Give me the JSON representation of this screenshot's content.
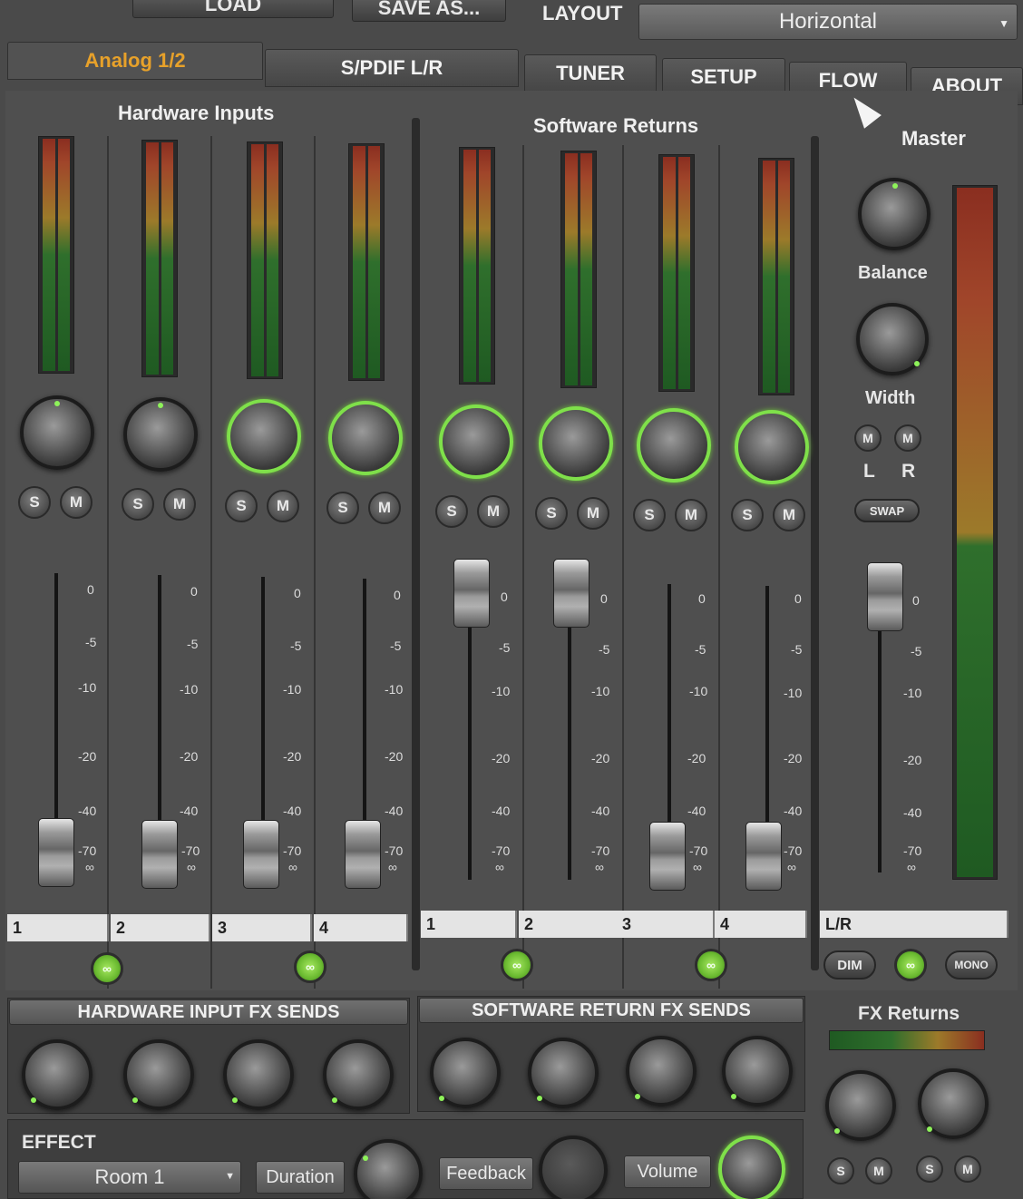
{
  "topbar": {
    "load_label": "LOAD",
    "save_as_label": "SAVE AS...",
    "layout_label": "LAYOUT",
    "layout_value": "Horizontal"
  },
  "tabs": [
    {
      "label": "Analog 1/2",
      "active": true
    },
    {
      "label": "S/PDIF L/R",
      "active": false
    },
    {
      "label": "TUNER",
      "active": false
    },
    {
      "label": "SETUP",
      "active": false
    },
    {
      "label": "FLOW",
      "active": false
    },
    {
      "label": "ABOUT",
      "active": false
    }
  ],
  "sections": {
    "hardware_inputs": "Hardware Inputs",
    "software_returns": "Software Returns",
    "master": "Master"
  },
  "channel_buttons": {
    "solo": "S",
    "mute": "M"
  },
  "fader_scale": [
    "0",
    "-5",
    "-10",
    "-20",
    "-40",
    "-70",
    "∞"
  ],
  "hardware_channels": [
    {
      "name": "1",
      "pan_ring": false
    },
    {
      "name": "2",
      "pan_ring": false
    },
    {
      "name": "3",
      "pan_ring": true
    },
    {
      "name": "4",
      "pan_ring": true
    }
  ],
  "software_channels": [
    {
      "name": "1",
      "pan_ring": true
    },
    {
      "name": "2",
      "pan_ring": true
    },
    {
      "name": "3",
      "pan_ring": true
    },
    {
      "name": "4",
      "pan_ring": true
    }
  ],
  "link_label": "∞",
  "master": {
    "balance_label": "Balance",
    "width_label": "Width",
    "m_label": "M",
    "l_label": "L",
    "r_label": "R",
    "swap_label": "SWAP",
    "name": "L/R",
    "dim_label": "DIM",
    "mono_label": "MONO"
  },
  "fx": {
    "hardware_sends_label": "HARDWARE INPUT FX SENDS",
    "software_sends_label": "SOFTWARE RETURN FX SENDS",
    "returns_label": "FX Returns",
    "effect_label": "EFFECT",
    "effect_value": "Room 1",
    "duration_label": "Duration",
    "feedback_label": "Feedback",
    "volume_label": "Volume"
  },
  "colors": {
    "accent_tab": "#e7a12a",
    "knob_ring": "#7fe04a"
  }
}
